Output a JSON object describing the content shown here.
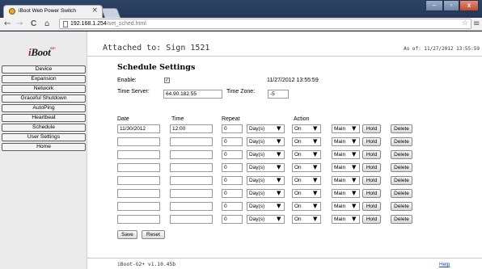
{
  "browser": {
    "tab_title": "iBoot Web Power Switch",
    "tab_close": "×",
    "url_host": "192.168.1.254",
    "url_path": "/set_sched.html",
    "back_glyph": "←",
    "forward_glyph": "→",
    "reload_glyph": "C",
    "home_glyph": "⌂",
    "star_glyph": "☆",
    "menu_glyph": "≡",
    "window_minimize": "–",
    "window_maximize": "▫",
    "window_close": "x"
  },
  "sidebar": {
    "logo_i": "i",
    "logo_rest": "Boot",
    "logo_sup": "G2+",
    "items": [
      {
        "label": "Device"
      },
      {
        "label": "Expansion"
      },
      {
        "label": "Network"
      },
      {
        "label": "Graceful Shutdown"
      },
      {
        "label": "AutoPing"
      },
      {
        "label": "Heartbeat"
      },
      {
        "label": "Schedule"
      },
      {
        "label": "User Settings"
      },
      {
        "label": "Home"
      }
    ]
  },
  "header": {
    "attached_to": "Attached to: Sign 1521",
    "as_of": "As of: 11/27/2012 13:55:59"
  },
  "schedule": {
    "title": "Schedule Settings",
    "enable_label": "Enable:",
    "enable_checked": "✓",
    "current_datetime": "11/27/2012 13:55:59",
    "time_server_label": "Time Server:",
    "time_server_value": "64.90.182.55",
    "time_zone_label": "Time Zone:",
    "time_zone_value": "-5",
    "columns": {
      "date": "Date",
      "time": "Time",
      "repeat": "Repeat",
      "action": "Action"
    },
    "rows": [
      {
        "date": "11/30/2012",
        "time": "12:00",
        "repeat_value": "0",
        "repeat_unit": "Day(s)",
        "action": "On",
        "outlet": "Main",
        "hold": "Hold",
        "delete": "Delete"
      },
      {
        "date": "",
        "time": "",
        "repeat_value": "0",
        "repeat_unit": "Day(s)",
        "action": "On",
        "outlet": "Main",
        "hold": "Hold",
        "delete": "Delete"
      },
      {
        "date": "",
        "time": "",
        "repeat_value": "0",
        "repeat_unit": "Day(s)",
        "action": "On",
        "outlet": "Main",
        "hold": "Hold",
        "delete": "Delete"
      },
      {
        "date": "",
        "time": "",
        "repeat_value": "0",
        "repeat_unit": "Day(s)",
        "action": "On",
        "outlet": "Main",
        "hold": "Hold",
        "delete": "Delete"
      },
      {
        "date": "",
        "time": "",
        "repeat_value": "0",
        "repeat_unit": "Day(s)",
        "action": "On",
        "outlet": "Main",
        "hold": "Hold",
        "delete": "Delete"
      },
      {
        "date": "",
        "time": "",
        "repeat_value": "0",
        "repeat_unit": "Day(s)",
        "action": "On",
        "outlet": "Main",
        "hold": "Hold",
        "delete": "Delete"
      },
      {
        "date": "",
        "time": "",
        "repeat_value": "0",
        "repeat_unit": "Day(s)",
        "action": "On",
        "outlet": "Main",
        "hold": "Hold",
        "delete": "Delete"
      },
      {
        "date": "",
        "time": "",
        "repeat_value": "0",
        "repeat_unit": "Day(s)",
        "action": "On",
        "outlet": "Main",
        "hold": "Hold",
        "delete": "Delete"
      }
    ],
    "save_label": "Save",
    "reset_label": "Reset"
  },
  "footer": {
    "version": "iBoot-G2+ v1.10.45b",
    "help_label": "Help"
  }
}
